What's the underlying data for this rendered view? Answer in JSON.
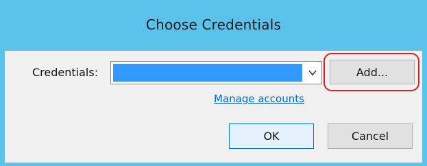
{
  "window": {
    "title": "Choose Credentials"
  },
  "form": {
    "credentials_label": "Credentials:",
    "credentials_value": "",
    "add_label": "Add...",
    "manage_link": "Manage accounts",
    "ok_label": "OK",
    "cancel_label": "Cancel"
  },
  "colors": {
    "titlebar": "#5bc2ec",
    "selection": "#3399ff",
    "highlight": "#e02020",
    "link": "#0066cc"
  },
  "icons": {
    "dropdown": "chevron-down-icon"
  }
}
